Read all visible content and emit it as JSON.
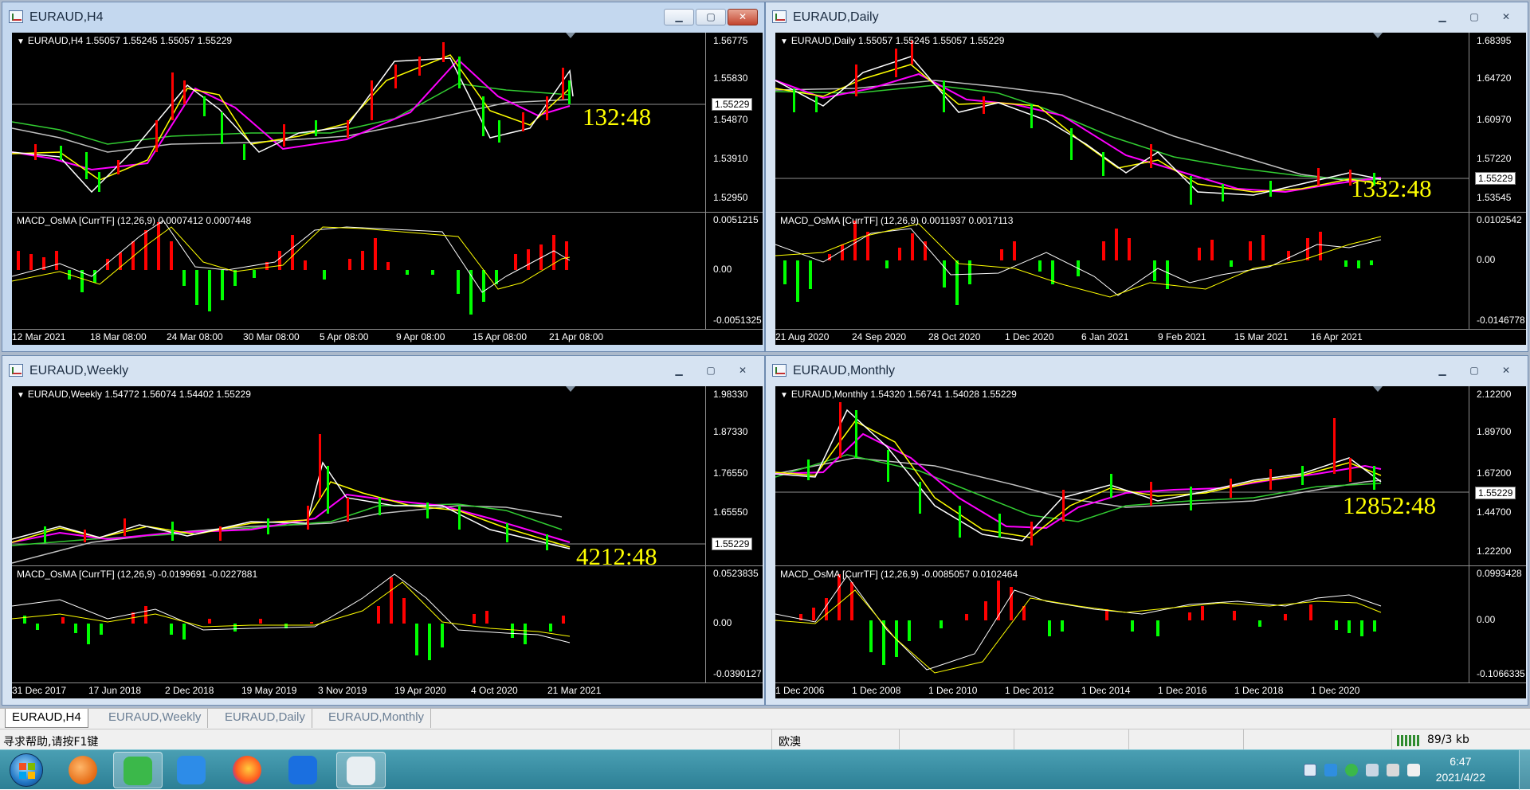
{
  "windows": [
    {
      "key": "h4",
      "title": "EURAUD,H4",
      "active": true,
      "legend": "EURAUD,H4  1.55057 1.55245 1.55057 1.55229",
      "macd_legend": "MACD_OsMA [CurrTF] (12,26,9) 0.0007412 0.0007448",
      "price_ticks": [
        "1.56775",
        "1.55830",
        "1.54870",
        "1.53910",
        "1.52950"
      ],
      "current_price": "1.55229",
      "macd_ticks": [
        "0.0051215",
        "0.00",
        "-0.0051325"
      ],
      "timer": "132:48",
      "x_ticks": [
        "12 Mar 2021",
        "18 Mar 08:00",
        "24 Mar 08:00",
        "30 Mar 08:00",
        "5 Apr 08:00",
        "9 Apr 08:00",
        "15 Apr 08:00",
        "21 Apr 08:00"
      ],
      "buttons": {
        "minimize": "▁",
        "maximize": "▢",
        "close": "✕"
      }
    },
    {
      "key": "daily",
      "title": "EURAUD,Daily",
      "active": false,
      "legend": "EURAUD,Daily  1.55057 1.55245 1.55057 1.55229",
      "macd_legend": "MACD_OsMA [CurrTF] (12,26,9) 0.0011937 0.0017113",
      "price_ticks": [
        "1.68395",
        "1.64720",
        "1.60970",
        "1.57220",
        "1.53545"
      ],
      "current_price": "1.55229",
      "macd_ticks": [
        "0.0102542",
        "0.00",
        "-0.0146778"
      ],
      "timer": "1332:48",
      "x_ticks": [
        "21 Aug 2020",
        "24 Sep 2020",
        "28 Oct 2020",
        "1 Dec 2020",
        "6 Jan 2021",
        "9 Feb 2021",
        "15 Mar 2021",
        "16 Apr 2021"
      ],
      "buttons": {
        "minimize": "▁",
        "maximize": "▢",
        "close": "✕"
      }
    },
    {
      "key": "weekly",
      "title": "EURAUD,Weekly",
      "active": false,
      "legend": "EURAUD,Weekly  1.54772 1.56074 1.54402 1.55229",
      "macd_legend": "MACD_OsMA [CurrTF] (12,26,9) -0.0199691 -0.0227881",
      "price_ticks": [
        "1.98330",
        "1.87330",
        "1.76550",
        "1.65550",
        "1.55229"
      ],
      "current_price": "1.55229",
      "macd_ticks": [
        "0.0523835",
        "0.00",
        "-0.0390127"
      ],
      "timer": "4212:48",
      "x_ticks": [
        "31 Dec 2017",
        "17 Jun 2018",
        "2 Dec 2018",
        "19 May 2019",
        "3 Nov 2019",
        "19 Apr 2020",
        "4 Oct 2020",
        "21 Mar 2021"
      ],
      "buttons": {
        "minimize": "▁",
        "maximize": "▢",
        "close": "✕"
      }
    },
    {
      "key": "monthly",
      "title": "EURAUD,Monthly",
      "active": false,
      "legend": "EURAUD,Monthly  1.54320 1.56741 1.54028 1.55229",
      "macd_legend": "MACD_OsMA [CurrTF] (12,26,9) -0.0085057 0.0102464",
      "price_ticks": [
        "2.12200",
        "1.89700",
        "1.67200",
        "1.44700",
        "1.22200"
      ],
      "current_price": "1.55229",
      "macd_ticks": [
        "0.0993428",
        "0.00",
        "-0.1066335"
      ],
      "timer": "12852:48",
      "x_ticks": [
        "1 Dec 2006",
        "1 Dec 2008",
        "1 Dec 2010",
        "1 Dec 2012",
        "1 Dec 2014",
        "1 Dec 2016",
        "1 Dec 2018",
        "1 Dec 2020"
      ],
      "buttons": {
        "minimize": "▁",
        "maximize": "▢",
        "close": "✕"
      }
    }
  ],
  "tabs": [
    "EURAUD,H4",
    "EURAUD,Weekly",
    "EURAUD,Daily",
    "EURAUD,Monthly"
  ],
  "status": {
    "help": "寻求帮助,请按F1键",
    "profile": "欧澳",
    "traffic": "89/3 kb"
  },
  "clock": {
    "time": "6:47",
    "date": "2021/4/22"
  },
  "colors": {
    "chart_bg": "#000000",
    "bull": "#00ff00",
    "bear": "#ff0000",
    "ma_white": "#ffffff",
    "ma_yellow": "#ffff00",
    "ma_magenta": "#ff00ff",
    "ma_green": "#32cd32",
    "ma_silver": "#c0c0c0",
    "timer": "#ffff00"
  }
}
